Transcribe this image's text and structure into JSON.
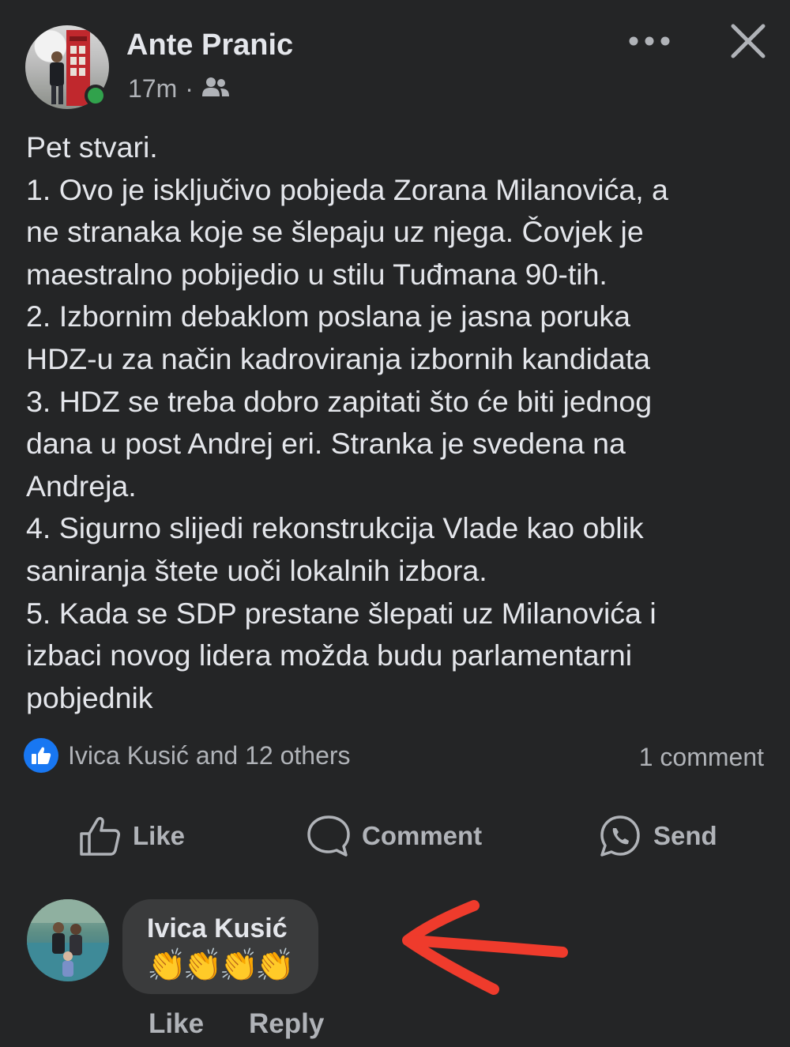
{
  "post": {
    "author": "Ante Pranic",
    "time": "17m",
    "separator": "·",
    "audience_icon": "friends-icon",
    "lines": [
      "Pet stvari.",
      "1. Ovo je isključivo pobjeda Zorana Milanovića, a",
      "ne stranaka koje se šlepaju uz njega. Čovjek je",
      "maestralno pobijedio u stilu Tuđmana 90-tih.",
      "2. Izbornim debaklom poslana je jasna poruka",
      "HDZ-u za način kadroviranja izbornih kandidata",
      "3. HDZ se treba dobro zapitati što će biti jednog",
      "dana u post Andrej eri. Stranka je svedena na",
      "Andreja.",
      "4. Sigurno slijedi rekonstrukcija Vlade kao oblik",
      "saniranja štete uoči lokalnih izbora.",
      "5. Kada se SDP prestane šlepati uz Milanovića i",
      "izbaci novog lidera možda budu parlamentarni",
      "pobjednik"
    ],
    "reactions_text": "Ivica Kusić and 12 others",
    "comment_count": "1 comment"
  },
  "actions": {
    "like": "Like",
    "comment": "Comment",
    "send": "Send"
  },
  "comment": {
    "author": "Ivica Kusić",
    "text": "👏👏👏👏",
    "like": "Like",
    "reply": "Reply"
  },
  "colors": {
    "background": "#242526",
    "accent_blue": "#1877f2",
    "online_green": "#31a24c",
    "annotation_red": "#ef3b2c"
  }
}
